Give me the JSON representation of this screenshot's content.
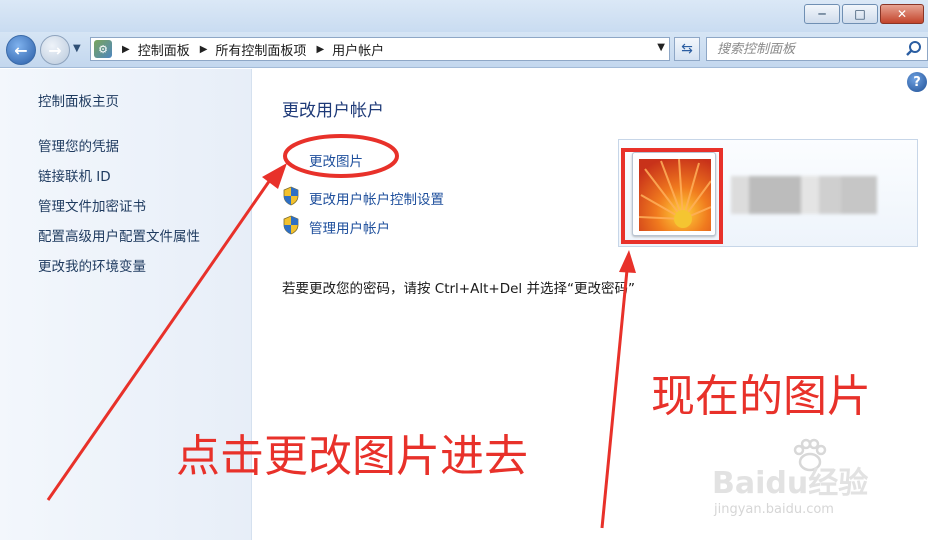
{
  "window": {
    "minimize_glyph": "─",
    "maximize_glyph": "□",
    "close_glyph": "✕"
  },
  "nav": {
    "back_glyph": "←",
    "forward_glyph": "→",
    "breadcrumbs": [
      "控制面板",
      "所有控制面板项",
      "用户帐户"
    ],
    "refresh_glyph": "⇆",
    "search_placeholder": "搜索控制面板"
  },
  "sidebar": {
    "home": "控制面板主页",
    "items": [
      "管理您的凭据",
      "链接联机 ID",
      "管理文件加密证书",
      "配置高级用户配置文件属性",
      "更改我的环境变量"
    ]
  },
  "main": {
    "help_glyph": "?",
    "title": "更改用户帐户",
    "tasks": [
      "更改图片",
      "更改用户帐户控制设置",
      "管理用户帐户"
    ],
    "note": "若要更改您的密码，请按 Ctrl+Alt+Del 并选择“更改密码”"
  },
  "annotations": {
    "click_hint": "点击更改图片进去",
    "current_picture": "现在的图片"
  },
  "watermark": {
    "brand": "Baidu经验",
    "url": "jingyan.baidu.com"
  },
  "colors": {
    "annotation_red": "#e8312a",
    "link_blue": "#1e4f9c",
    "title_blue": "#1e3a78"
  }
}
